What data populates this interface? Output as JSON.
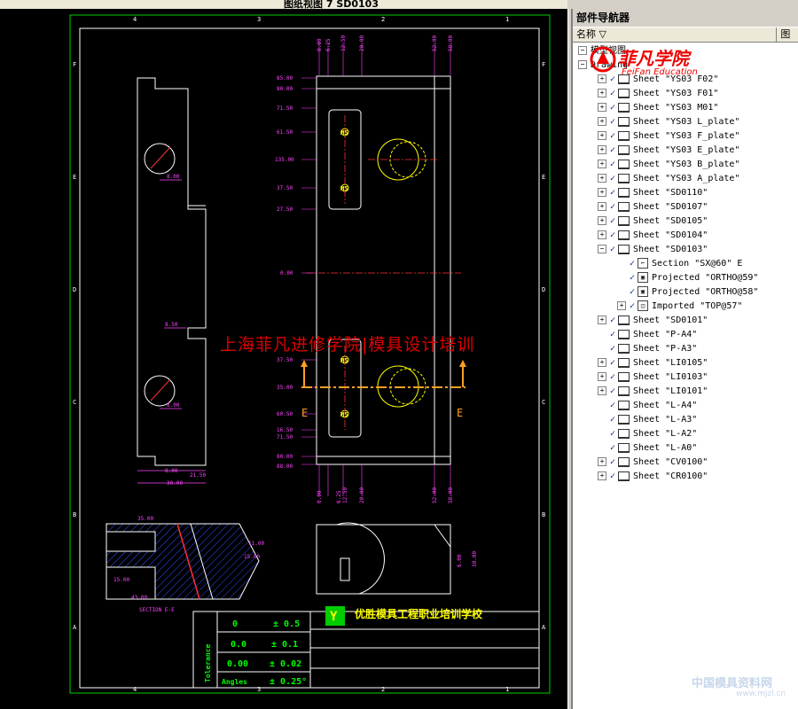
{
  "window": {
    "title_fragment": "图纸视图 7 SD0103"
  },
  "drawing": {
    "border_top_letters": [
      "4",
      "3",
      "2",
      "1"
    ],
    "border_side_letters": [
      "F",
      "E",
      "D",
      "C",
      "B",
      "A"
    ],
    "front_view_dims_top": [
      "0.00",
      "6.25",
      "12.50",
      "20.00",
      "52.00",
      "58.00"
    ],
    "front_view_dims_left": [
      "85.00",
      "80.00",
      "71.50",
      "61.50",
      "135.00",
      "37.50",
      "27.50",
      "0.00",
      "37.50",
      "35.00",
      "60.50",
      "16.50",
      "71.50",
      "80.00",
      "88.00"
    ],
    "front_view_dims_bottom": [
      "0.00",
      "6.25",
      "12.50",
      "20.00",
      "52.00",
      "58.00"
    ],
    "side_view_dims": [
      "8.00",
      "8.50",
      "8.00",
      "8.00",
      "21.50",
      "30.00"
    ],
    "section_dims": [
      "35.00",
      "15.00",
      "43.00",
      "15.00",
      "11.00"
    ],
    "holes": [
      "M5",
      "M5",
      "M5",
      "M5"
    ],
    "section_label": "SECTION E-E",
    "section_marker": "E",
    "right_view_dims": [
      "6.00",
      "30.00"
    ],
    "overlay_text": "上海菲凡进修学院|模具设计培训",
    "title_block": {
      "school_name": "优胜模具工程职业培训学校",
      "tolerance_label": "Tolerance",
      "tolerances": [
        {
          "digits": "0",
          "value": "± 0.5"
        },
        {
          "digits": "0.0",
          "value": "± 0.1"
        },
        {
          "digits": "0.00",
          "value": "± 0.02"
        },
        {
          "digits": "Angles",
          "value": "± 0.25°"
        }
      ]
    }
  },
  "navigator": {
    "title": "部件导航器",
    "col_name": "名称",
    "col_other": "图",
    "root": "模型视图",
    "drawing": "Drawing",
    "sheets": [
      {
        "label": "Sheet \"YS03 F02\"",
        "expanded": false
      },
      {
        "label": "Sheet \"YS03 F01\"",
        "expanded": false
      },
      {
        "label": "Sheet \"YS03 M01\"",
        "expanded": false
      },
      {
        "label": "Sheet \"YS03 L_plate\"",
        "expanded": false
      },
      {
        "label": "Sheet \"YS03 F_plate\"",
        "expanded": false
      },
      {
        "label": "Sheet \"YS03 E_plate\"",
        "expanded": false
      },
      {
        "label": "Sheet \"YS03 B_plate\"",
        "expanded": false
      },
      {
        "label": "Sheet \"YS03 A_plate\"",
        "expanded": false
      },
      {
        "label": "Sheet \"SD0110\"",
        "expanded": false
      },
      {
        "label": "Sheet \"SD0107\"",
        "expanded": false
      },
      {
        "label": "Sheet \"SD0105\"",
        "expanded": false
      },
      {
        "label": "Sheet \"SD0104\"",
        "expanded": false
      },
      {
        "label": "Sheet \"SD0103\"",
        "expanded": true
      }
    ],
    "children": [
      {
        "label": "Section \"SX@60\" E",
        "type": "section"
      },
      {
        "label": "Projected \"ORTHO@59\"",
        "type": "projected"
      },
      {
        "label": "Projected \"ORTHO@58\"",
        "type": "projected"
      },
      {
        "label": "Imported \"TOP@57\"",
        "type": "imported"
      }
    ],
    "sheets_after": [
      {
        "label": "Sheet \"SD0101\"",
        "has_toggle": true
      },
      {
        "label": "Sheet \"P-A4\"",
        "has_toggle": false
      },
      {
        "label": "Sheet \"P-A3\"",
        "has_toggle": false
      },
      {
        "label": "Sheet \"LI0105\"",
        "has_toggle": true
      },
      {
        "label": "Sheet \"LI0103\"",
        "has_toggle": true
      },
      {
        "label": "Sheet \"LI0101\"",
        "has_toggle": true
      },
      {
        "label": "Sheet \"L-A4\"",
        "has_toggle": false
      },
      {
        "label": "Sheet \"L-A3\"",
        "has_toggle": false
      },
      {
        "label": "Sheet \"L-A2\"",
        "has_toggle": false
      },
      {
        "label": "Sheet \"L-A0\"",
        "has_toggle": false
      },
      {
        "label": "Sheet \"CV0100\"",
        "has_toggle": true
      },
      {
        "label": "Sheet \"CR0100\"",
        "has_toggle": true
      }
    ]
  },
  "branding": {
    "logo_cn": "菲凡学院",
    "logo_en": "FeiFan Education",
    "watermark_cn": "中国模具资料网",
    "watermark_url": "www.mjzl.cn"
  }
}
